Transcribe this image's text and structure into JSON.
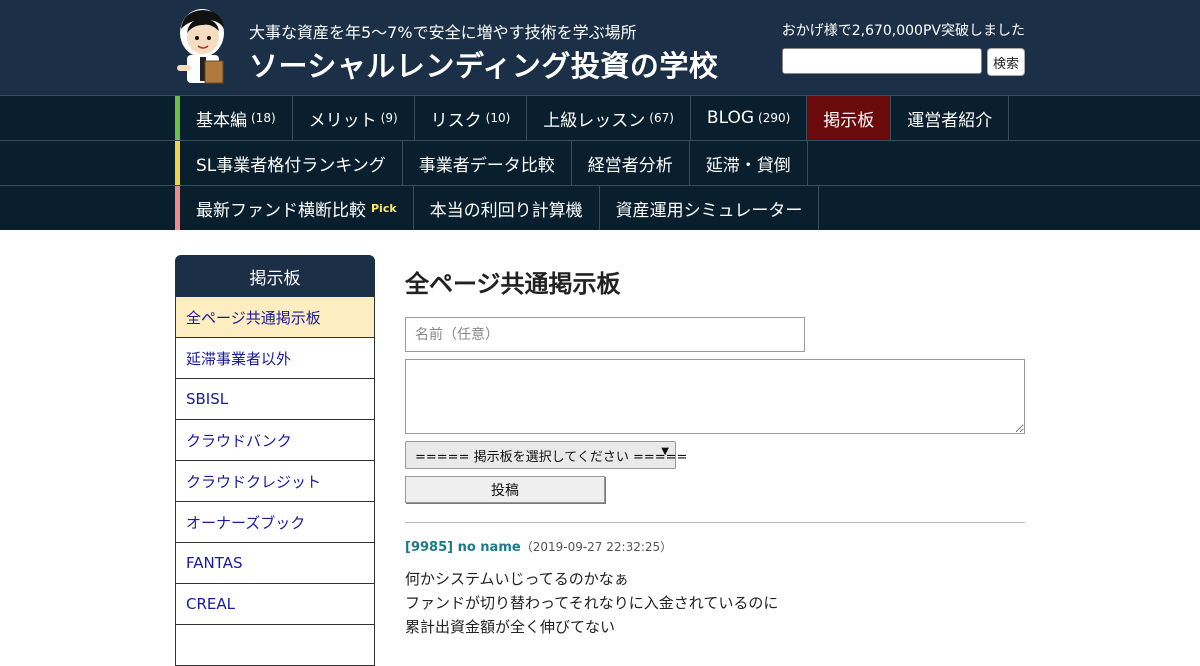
{
  "header": {
    "tagline": "大事な資産を年5～7%で安全に増やす技術を学ぶ場所",
    "site_title": "ソーシャルレンディング投資の学校",
    "pv_text": "おかげ様で2,670,000PV突破しました",
    "search_button": "検索",
    "search_value": ""
  },
  "nav": {
    "row1": [
      {
        "label": "基本編",
        "count": "(18)"
      },
      {
        "label": "メリット",
        "count": "(9)"
      },
      {
        "label": "リスク",
        "count": "(10)"
      },
      {
        "label": "上級レッスン",
        "count": "(67)"
      },
      {
        "label": "BLOG",
        "count": "(290)"
      },
      {
        "label": "掲示板",
        "count": ""
      },
      {
        "label": "運営者紹介",
        "count": ""
      }
    ],
    "row2": [
      {
        "label": "SL事業者格付ランキング"
      },
      {
        "label": "事業者データ比較"
      },
      {
        "label": "経営者分析"
      },
      {
        "label": "延滞・貸倒"
      }
    ],
    "row3": [
      {
        "label": "最新ファンド横断比較",
        "badge": "Pick"
      },
      {
        "label": "本当の利回り計算機"
      },
      {
        "label": "資産運用シミュレーター"
      }
    ],
    "accent_colors": [
      "#6cc04a",
      "#f3d24a",
      "#f08a8a"
    ],
    "active_color": "#6b0a0a"
  },
  "sidebar": {
    "header": "掲示板",
    "items": [
      "全ページ共通掲示板",
      "延滞事業者以外",
      "SBISL",
      "クラウドバンク",
      "クラウドクレジット",
      "オーナーズブック",
      "FANTAS",
      "CREAL",
      ""
    ]
  },
  "main": {
    "page_title": "全ページ共通掲示板",
    "name_placeholder": "名前（任意）",
    "message_value": "",
    "board_select": "===== 掲示板を選択してください =====",
    "post_button": "投稿"
  },
  "post": {
    "author": "[9985] no name",
    "date": "（2019-09-27 22:32:25）",
    "lines": [
      "何かシステムいじってるのかなぁ",
      "ファンドが切り替わってそれなりに入金されているのに",
      "累計出資金額が全く伸びてない"
    ]
  }
}
